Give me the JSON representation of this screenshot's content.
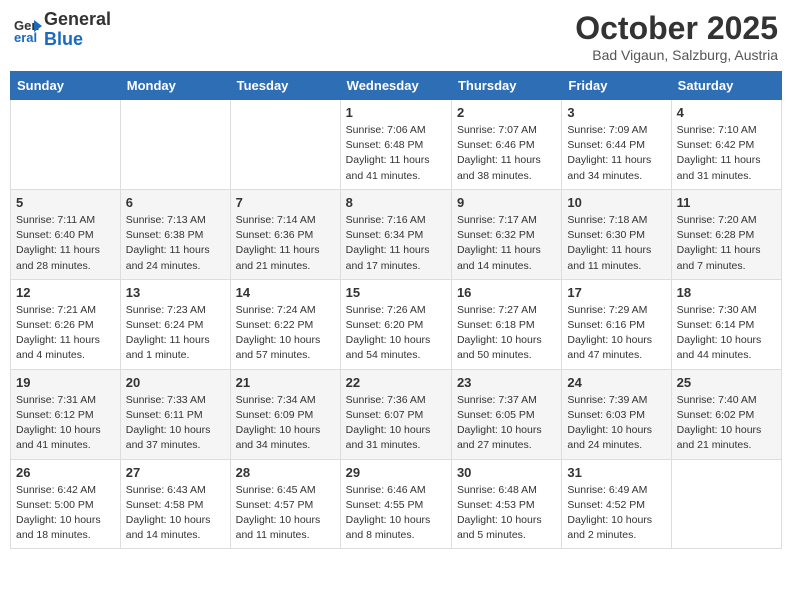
{
  "logo": {
    "general": "General",
    "blue": "Blue"
  },
  "header": {
    "month_title": "October 2025",
    "location": "Bad Vigaun, Salzburg, Austria"
  },
  "weekdays": [
    "Sunday",
    "Monday",
    "Tuesday",
    "Wednesday",
    "Thursday",
    "Friday",
    "Saturday"
  ],
  "weeks": [
    [
      {
        "day": "",
        "info": ""
      },
      {
        "day": "",
        "info": ""
      },
      {
        "day": "",
        "info": ""
      },
      {
        "day": "1",
        "info": "Sunrise: 7:06 AM\nSunset: 6:48 PM\nDaylight: 11 hours and 41 minutes."
      },
      {
        "day": "2",
        "info": "Sunrise: 7:07 AM\nSunset: 6:46 PM\nDaylight: 11 hours and 38 minutes."
      },
      {
        "day": "3",
        "info": "Sunrise: 7:09 AM\nSunset: 6:44 PM\nDaylight: 11 hours and 34 minutes."
      },
      {
        "day": "4",
        "info": "Sunrise: 7:10 AM\nSunset: 6:42 PM\nDaylight: 11 hours and 31 minutes."
      }
    ],
    [
      {
        "day": "5",
        "info": "Sunrise: 7:11 AM\nSunset: 6:40 PM\nDaylight: 11 hours and 28 minutes."
      },
      {
        "day": "6",
        "info": "Sunrise: 7:13 AM\nSunset: 6:38 PM\nDaylight: 11 hours and 24 minutes."
      },
      {
        "day": "7",
        "info": "Sunrise: 7:14 AM\nSunset: 6:36 PM\nDaylight: 11 hours and 21 minutes."
      },
      {
        "day": "8",
        "info": "Sunrise: 7:16 AM\nSunset: 6:34 PM\nDaylight: 11 hours and 17 minutes."
      },
      {
        "day": "9",
        "info": "Sunrise: 7:17 AM\nSunset: 6:32 PM\nDaylight: 11 hours and 14 minutes."
      },
      {
        "day": "10",
        "info": "Sunrise: 7:18 AM\nSunset: 6:30 PM\nDaylight: 11 hours and 11 minutes."
      },
      {
        "day": "11",
        "info": "Sunrise: 7:20 AM\nSunset: 6:28 PM\nDaylight: 11 hours and 7 minutes."
      }
    ],
    [
      {
        "day": "12",
        "info": "Sunrise: 7:21 AM\nSunset: 6:26 PM\nDaylight: 11 hours and 4 minutes."
      },
      {
        "day": "13",
        "info": "Sunrise: 7:23 AM\nSunset: 6:24 PM\nDaylight: 11 hours and 1 minute."
      },
      {
        "day": "14",
        "info": "Sunrise: 7:24 AM\nSunset: 6:22 PM\nDaylight: 10 hours and 57 minutes."
      },
      {
        "day": "15",
        "info": "Sunrise: 7:26 AM\nSunset: 6:20 PM\nDaylight: 10 hours and 54 minutes."
      },
      {
        "day": "16",
        "info": "Sunrise: 7:27 AM\nSunset: 6:18 PM\nDaylight: 10 hours and 50 minutes."
      },
      {
        "day": "17",
        "info": "Sunrise: 7:29 AM\nSunset: 6:16 PM\nDaylight: 10 hours and 47 minutes."
      },
      {
        "day": "18",
        "info": "Sunrise: 7:30 AM\nSunset: 6:14 PM\nDaylight: 10 hours and 44 minutes."
      }
    ],
    [
      {
        "day": "19",
        "info": "Sunrise: 7:31 AM\nSunset: 6:12 PM\nDaylight: 10 hours and 41 minutes."
      },
      {
        "day": "20",
        "info": "Sunrise: 7:33 AM\nSunset: 6:11 PM\nDaylight: 10 hours and 37 minutes."
      },
      {
        "day": "21",
        "info": "Sunrise: 7:34 AM\nSunset: 6:09 PM\nDaylight: 10 hours and 34 minutes."
      },
      {
        "day": "22",
        "info": "Sunrise: 7:36 AM\nSunset: 6:07 PM\nDaylight: 10 hours and 31 minutes."
      },
      {
        "day": "23",
        "info": "Sunrise: 7:37 AM\nSunset: 6:05 PM\nDaylight: 10 hours and 27 minutes."
      },
      {
        "day": "24",
        "info": "Sunrise: 7:39 AM\nSunset: 6:03 PM\nDaylight: 10 hours and 24 minutes."
      },
      {
        "day": "25",
        "info": "Sunrise: 7:40 AM\nSunset: 6:02 PM\nDaylight: 10 hours and 21 minutes."
      }
    ],
    [
      {
        "day": "26",
        "info": "Sunrise: 6:42 AM\nSunset: 5:00 PM\nDaylight: 10 hours and 18 minutes."
      },
      {
        "day": "27",
        "info": "Sunrise: 6:43 AM\nSunset: 4:58 PM\nDaylight: 10 hours and 14 minutes."
      },
      {
        "day": "28",
        "info": "Sunrise: 6:45 AM\nSunset: 4:57 PM\nDaylight: 10 hours and 11 minutes."
      },
      {
        "day": "29",
        "info": "Sunrise: 6:46 AM\nSunset: 4:55 PM\nDaylight: 10 hours and 8 minutes."
      },
      {
        "day": "30",
        "info": "Sunrise: 6:48 AM\nSunset: 4:53 PM\nDaylight: 10 hours and 5 minutes."
      },
      {
        "day": "31",
        "info": "Sunrise: 6:49 AM\nSunset: 4:52 PM\nDaylight: 10 hours and 2 minutes."
      },
      {
        "day": "",
        "info": ""
      }
    ]
  ]
}
